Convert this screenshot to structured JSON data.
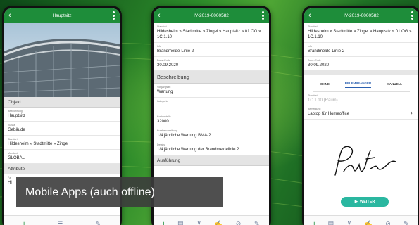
{
  "caption": "Mobile Apps (auch offline)",
  "colors": {
    "header": "#1e8d3a",
    "accent_blue": "#2a5fb0",
    "button": "#2ab7a0"
  },
  "phone1": {
    "title": "Hauptsitz",
    "sections": [
      "Objekt",
      "Attribute"
    ],
    "fields": [
      {
        "label": "Bezeichnung",
        "value": "Hauptsitz"
      },
      {
        "label": "Klasse",
        "value": "Gebäude"
      },
      {
        "label": "Standort",
        "value": "Hildesheim » Stadtmitte » Zingel"
      },
      {
        "label": "Mandant",
        "value": "GLOBAL"
      },
      {
        "label": "Fa",
        "value": "Hi"
      }
    ]
  },
  "phone2": {
    "title": "IV-2019-0000582",
    "fields_top": [
      {
        "label": "Standort",
        "value": "Hildesheim » Stadtmitte » Zingel » Hauptsitz » 01.OG » 1C.1.10"
      },
      {
        "label": "Info",
        "value": "Brandmelde-Linie 2"
      },
      {
        "label": "Dauv.-Ende",
        "value": "30.09.2020"
      }
    ],
    "section": "Beschreibung",
    "fields_bottom": [
      {
        "label": "Vorgangsart",
        "value": "Wartung"
      },
      {
        "label": "Kategorie",
        "value": ""
      },
      {
        "label": "Kostenstelle",
        "value": "32000"
      },
      {
        "label": "Kurzbeschreibung",
        "value": "1/4 jährliche Wartung BMA-2"
      },
      {
        "label": "Details",
        "value": "1/4 jährliche Wartung der Brandmeldelinie 2"
      }
    ],
    "section2": "Ausführung"
  },
  "phone3": {
    "title": "IV-2019-0000582",
    "fields_top": [
      {
        "label": "Standort",
        "value": "Hildesheim » Stadtmitte » Zingel » Hauptsitz » 01.OG » 1C.1.10"
      },
      {
        "label": "Info",
        "value": "Brandmelde-Linie 2"
      },
      {
        "label": "Dauv.-Ende",
        "value": "30.09.2020"
      }
    ],
    "segments": [
      "OHNE",
      "BEI EMPFÄNGER",
      "MANUELL"
    ],
    "standort_label": "Standort",
    "standort_value": "1C.1.10 (Raum)",
    "bemerkung_label": "Bemerkung",
    "bemerkung_value": "Laptop für Homeoffice",
    "button": "WEITER"
  }
}
